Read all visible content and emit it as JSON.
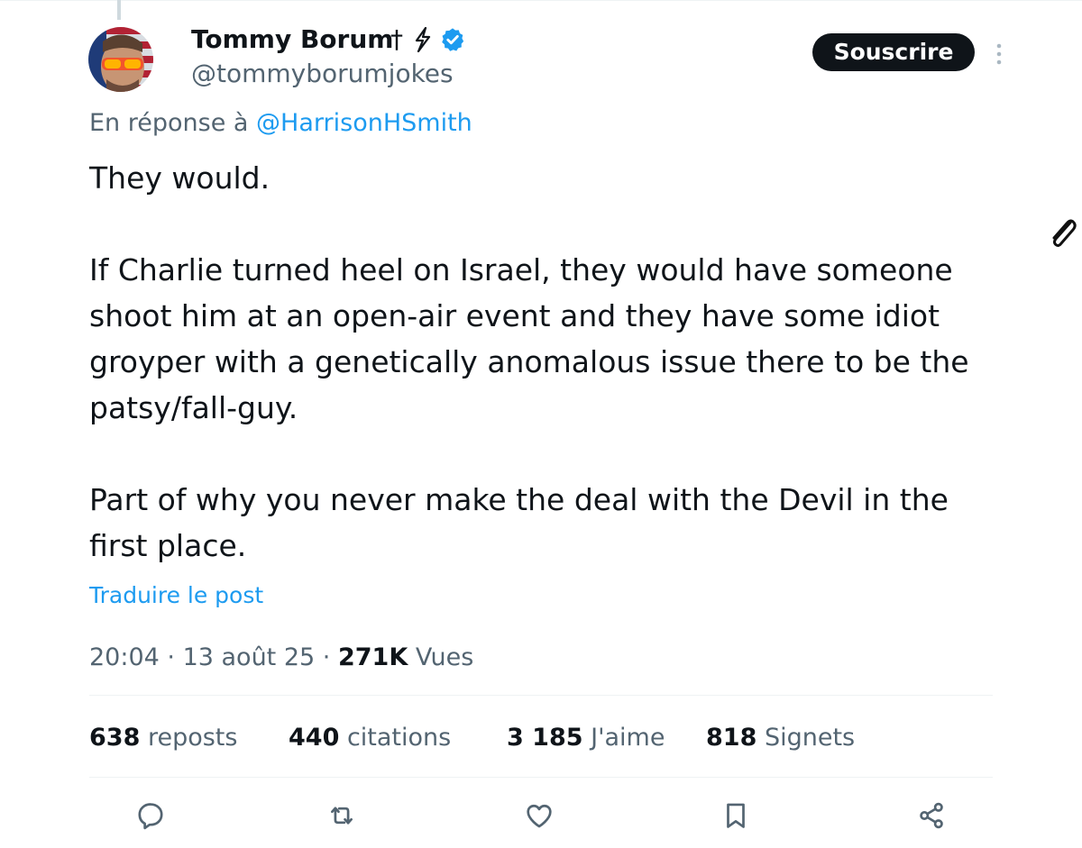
{
  "author": {
    "name": "Tommy Borum",
    "name_symbol": "†",
    "handle": "@tommyborumjokes",
    "verified": true
  },
  "header": {
    "subscribe_label": "Souscrire"
  },
  "reply": {
    "prefix": "En réponse à ",
    "handle": "@HarrisonHSmith"
  },
  "post": {
    "paragraphs": [
      "They would.",
      "If Charlie turned heel on Israel, they would have someone shoot him at an open-air event and they have some idiot groyper with a genetically anomalous issue there to be the patsy/fall-guy.",
      "Part of why you never make the deal with the Devil in the first place."
    ],
    "translate_label": "Traduire le post"
  },
  "meta": {
    "time": "20:04",
    "separator": " · ",
    "date": "13 août 25",
    "views_count": "271K",
    "views_label": " Vues"
  },
  "stats": [
    {
      "count": "638",
      "label": " reposts"
    },
    {
      "count": "440",
      "label": " citations"
    },
    {
      "count": "3 185",
      "label": " J'aime"
    },
    {
      "count": "818",
      "label": " Signets"
    }
  ],
  "actions": [
    "reply-icon",
    "repost-icon",
    "like-icon",
    "bookmark-icon",
    "share-icon"
  ],
  "colors": {
    "text": "#0f1419",
    "secondary": "#536471",
    "link": "#1d9bf0",
    "verified": "#1d9bf0",
    "divider": "#eff3f4"
  }
}
